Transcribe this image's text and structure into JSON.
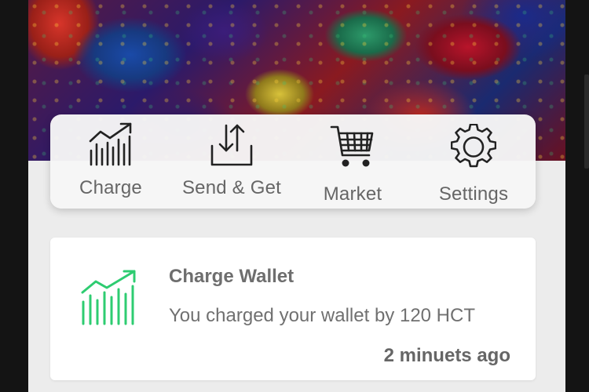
{
  "toolbar": {
    "items": [
      {
        "label": "Charge",
        "icon": "charge-chart-icon"
      },
      {
        "label": "Send & Get",
        "icon": "send-get-icon"
      },
      {
        "label": "Market",
        "icon": "cart-icon"
      },
      {
        "label": "Settings",
        "icon": "gear-icon"
      }
    ]
  },
  "notification": {
    "title": "Charge Wallet",
    "description": "You charged your wallet by 120 HCT",
    "time": "2 minuets ago",
    "icon": "charge-chart-icon",
    "accent_color": "#2ecc71"
  },
  "colors": {
    "background": "#ececec",
    "card": "#ffffff",
    "icon_dark": "#222222",
    "text_gray": "#6e6e6e"
  }
}
